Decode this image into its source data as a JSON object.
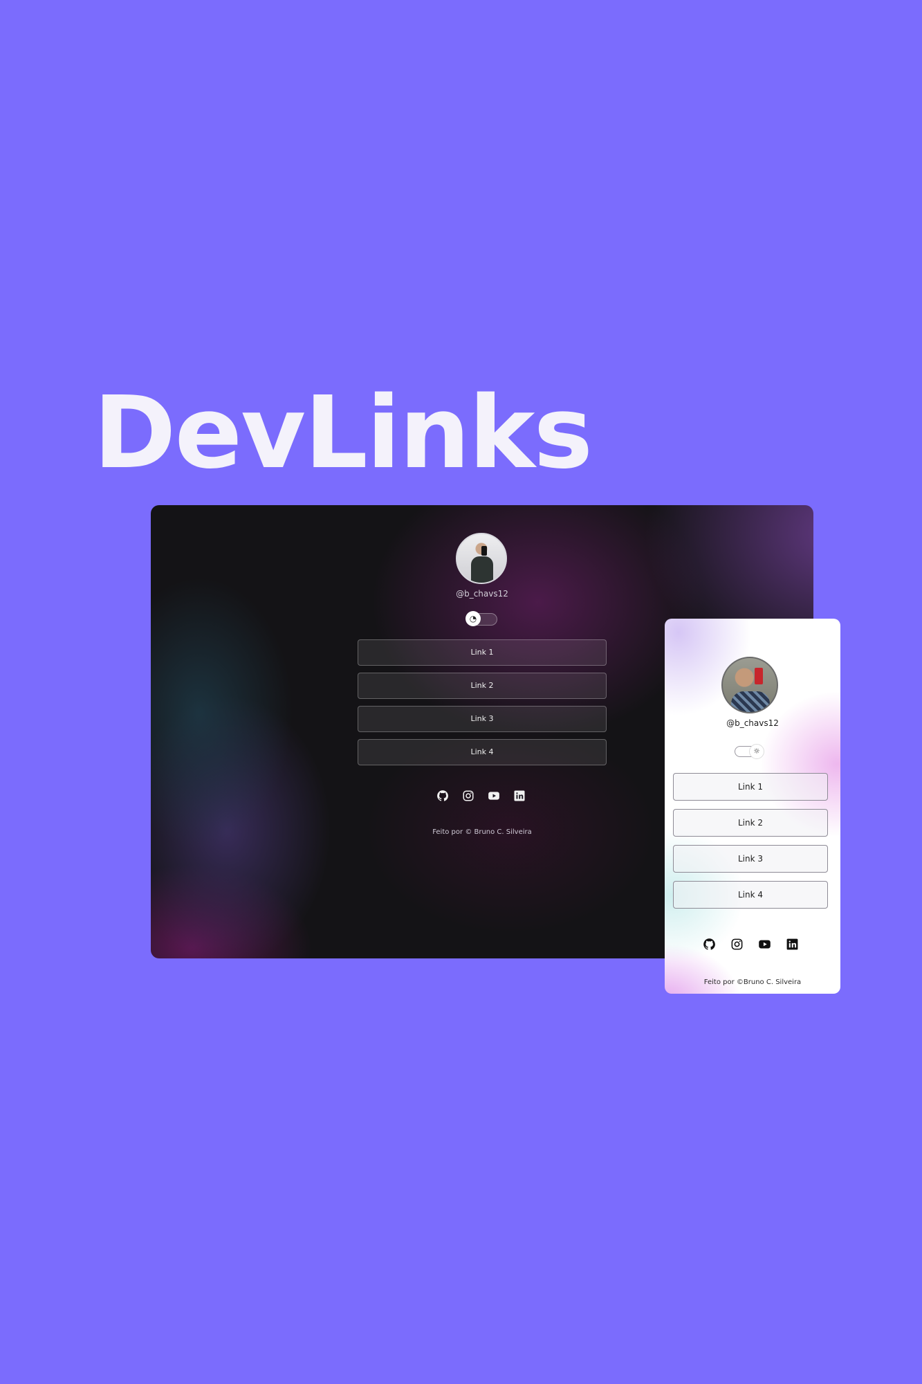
{
  "headline": "DevLinks",
  "desktop": {
    "handle": "@b_chavs12",
    "theme_toggle_icon": "moon-icon",
    "links": [
      "Link 1",
      "Link 2",
      "Link 3",
      "Link 4"
    ],
    "socials": [
      "github-icon",
      "instagram-icon",
      "youtube-icon",
      "linkedin-icon"
    ],
    "footer": "Feito por © Bruno C. Silveira"
  },
  "mobile": {
    "handle": "@b_chavs12",
    "theme_toggle_icon": "sun-icon",
    "links": [
      "Link 1",
      "Link 2",
      "Link 3",
      "Link 4"
    ],
    "socials": [
      "github-icon",
      "instagram-icon",
      "youtube-icon",
      "linkedin-icon"
    ],
    "footer": "Feito por ©Bruno C. Silveira"
  },
  "colors": {
    "background": "#7b6cfd",
    "headline": "#f4f2fb",
    "desktop_base": "#141316",
    "mobile_base": "#ffffff"
  }
}
